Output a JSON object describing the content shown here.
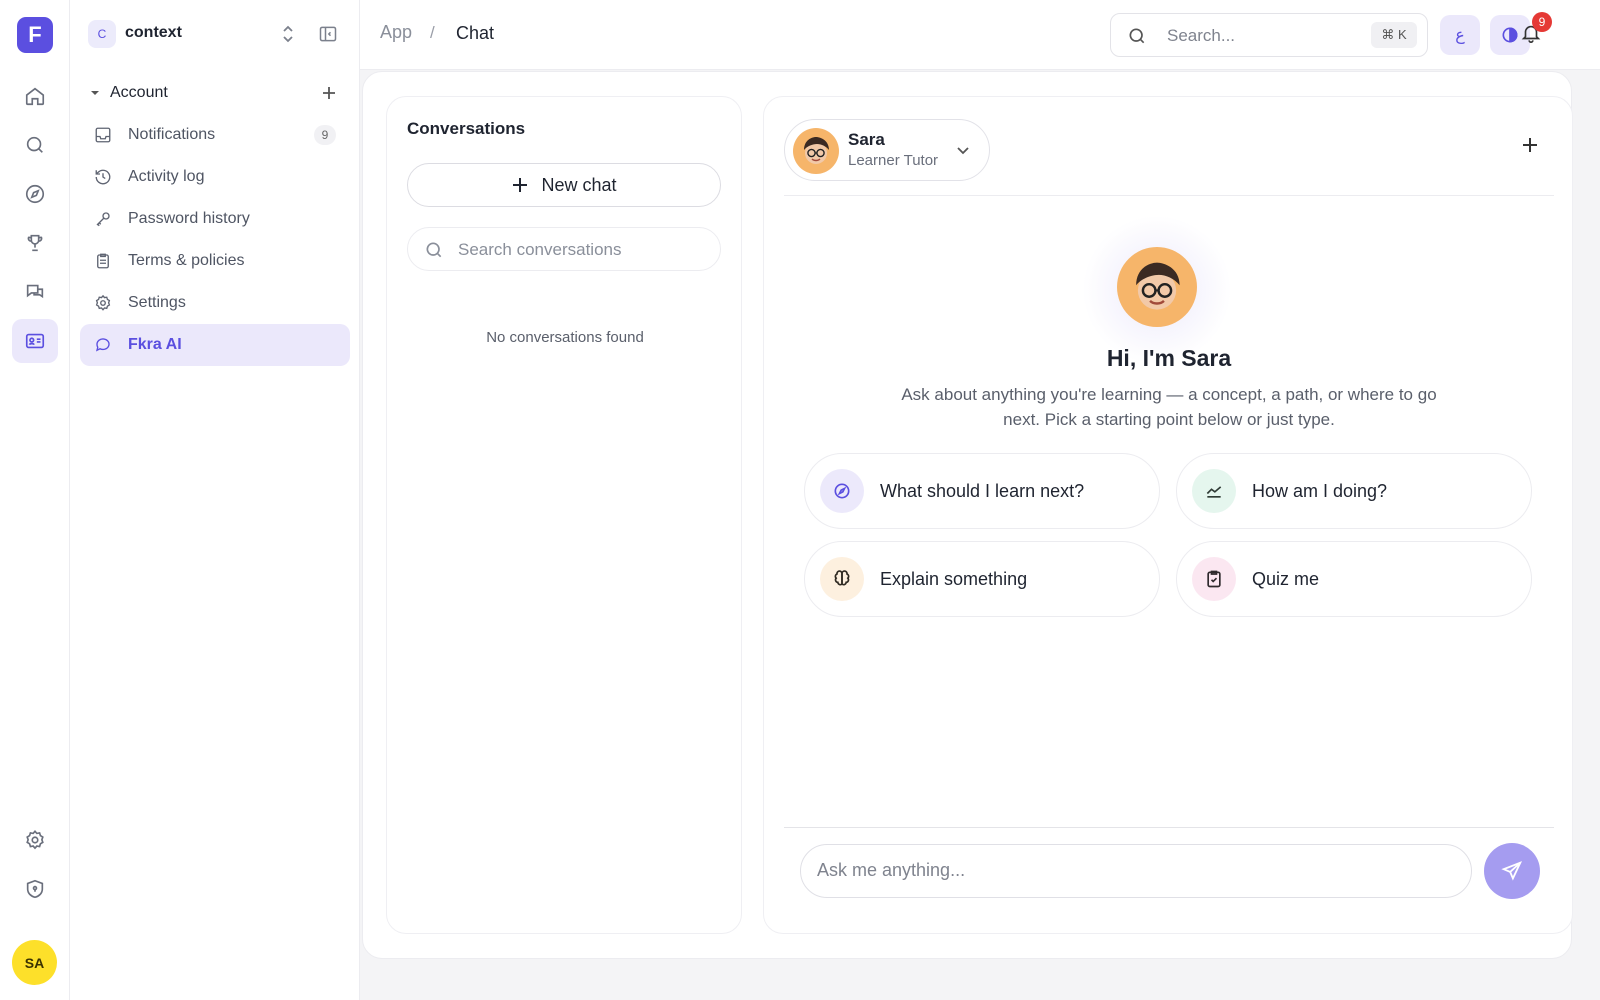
{
  "brand": {
    "logo_letter": "F",
    "accent": "#5b4fe0"
  },
  "rail": {
    "items": [
      "home-icon",
      "search-icon",
      "compass-icon",
      "trophy-icon",
      "messages-icon",
      "id-card-icon"
    ],
    "active": "id-card-icon",
    "bottom": [
      "gear-icon",
      "shield-icon"
    ],
    "user_initials": "SA"
  },
  "sidebar": {
    "workspace": {
      "badge": "C",
      "name": "context"
    },
    "section": {
      "title": "Account"
    },
    "items": [
      {
        "label": "Notifications",
        "icon": "inbox-icon",
        "count": "9"
      },
      {
        "label": "Activity log",
        "icon": "history-icon"
      },
      {
        "label": "Password history",
        "icon": "key-icon"
      },
      {
        "label": "Terms & policies",
        "icon": "clipboard-icon"
      },
      {
        "label": "Settings",
        "icon": "gear-icon"
      },
      {
        "label": "Fkra AI",
        "icon": "chat-bubble-icon",
        "active": true
      }
    ]
  },
  "topbar": {
    "breadcrumb": {
      "root": "App",
      "separator": "/",
      "current": "Chat"
    },
    "search": {
      "placeholder": "Search...",
      "shortcut": "⌘ K"
    },
    "lang_button": "ع",
    "notifications_count": "9"
  },
  "conversations": {
    "title": "Conversations",
    "new_chat": "New chat",
    "search_placeholder": "Search conversations",
    "empty": "No conversations found"
  },
  "chat": {
    "tutor": {
      "name": "Sara",
      "role": "Learner Tutor"
    },
    "greeting": "Hi, I'm Sara",
    "subtitle": "Ask about anything you're learning — a concept, a path, or where to go next. Pick a starting point below or just type.",
    "suggestions": [
      {
        "label": "What should I learn next?",
        "icon": "compass-icon",
        "bg": "#ece9fb"
      },
      {
        "label": "How am I doing?",
        "icon": "trend-icon",
        "bg": "#e5f6ee"
      },
      {
        "label": "Explain something",
        "icon": "brain-icon",
        "bg": "#fdf0df"
      },
      {
        "label": "Quiz me",
        "icon": "clipboard-check-icon",
        "bg": "#fbe7f1"
      }
    ],
    "input_placeholder": "Ask me anything..."
  }
}
